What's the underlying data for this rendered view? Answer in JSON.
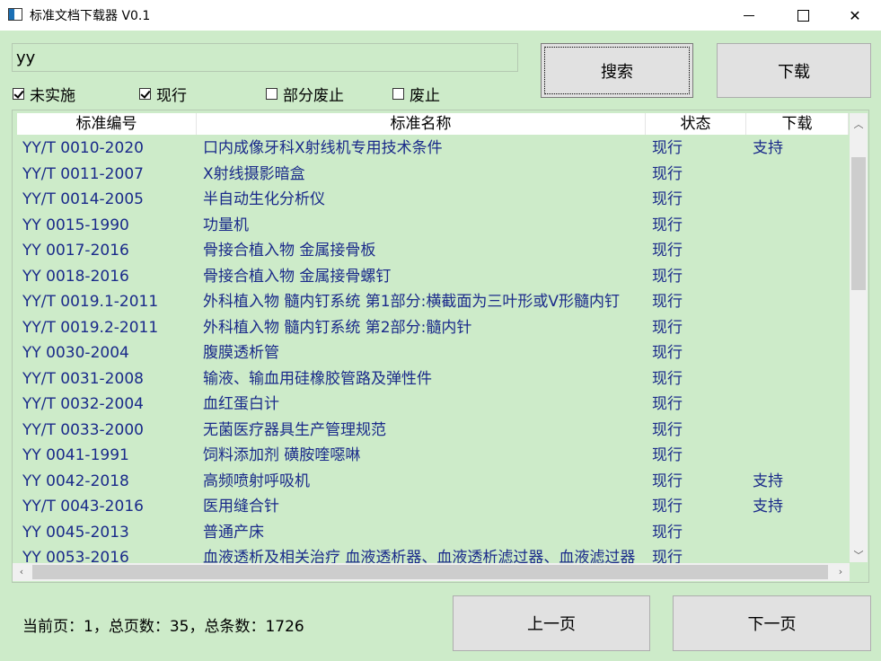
{
  "window": {
    "title": "标准文档下载器 V0.1"
  },
  "search": {
    "value": "yy",
    "search_label": "搜索",
    "download_label": "下载"
  },
  "filters": [
    {
      "label": "未实施",
      "checked": true
    },
    {
      "label": "现行",
      "checked": true
    },
    {
      "label": "部分废止",
      "checked": false
    },
    {
      "label": "废止",
      "checked": false
    }
  ],
  "table": {
    "headers": [
      "标准编号",
      "标准名称",
      "状态",
      "下载"
    ],
    "rows": [
      [
        "YY/T 0010-2020",
        "口内成像牙科X射线机专用技术条件",
        "现行",
        "支持"
      ],
      [
        "YY/T 0011-2007",
        "X射线摄影暗盒",
        "现行",
        ""
      ],
      [
        "YY/T 0014-2005",
        "半自动生化分析仪",
        "现行",
        ""
      ],
      [
        "YY 0015-1990",
        "功量机",
        "现行",
        ""
      ],
      [
        "YY 0017-2016",
        "骨接合植入物 金属接骨板",
        "现行",
        ""
      ],
      [
        "YY 0018-2016",
        "骨接合植入物 金属接骨螺钉",
        "现行",
        ""
      ],
      [
        "YY/T 0019.1-2011",
        "外科植入物 髓内钉系统 第1部分:横截面为三叶形或V形髓内钉",
        "现行",
        ""
      ],
      [
        "YY/T 0019.2-2011",
        "外科植入物 髓内钉系统 第2部分:髓内针",
        "现行",
        ""
      ],
      [
        "YY 0030-2004",
        "腹膜透析管",
        "现行",
        ""
      ],
      [
        "YY/T 0031-2008",
        "输液、输血用硅橡胶管路及弹性件",
        "现行",
        ""
      ],
      [
        "YY/T 0032-2004",
        "血红蛋白计",
        "现行",
        ""
      ],
      [
        "YY/T 0033-2000",
        "无菌医疗器具生产管理规范",
        "现行",
        ""
      ],
      [
        "YY 0041-1991",
        "饲料添加剂 磺胺喹噁啉",
        "现行",
        ""
      ],
      [
        "YY 0042-2018",
        "高频喷射呼吸机",
        "现行",
        "支持"
      ],
      [
        "YY/T 0043-2016",
        "医用缝合针",
        "现行",
        "支持"
      ],
      [
        "YY 0045-2013",
        "普通产床",
        "现行",
        ""
      ],
      [
        "YY 0053-2016",
        "血液透析及相关治疗 血液透析器、血液透析滤过器、血液滤过器",
        "现行",
        ""
      ]
    ]
  },
  "pager": {
    "status": "当前页：1，总页数：35，总条数：1726",
    "prev_label": "上一页",
    "next_label": "下一页"
  }
}
